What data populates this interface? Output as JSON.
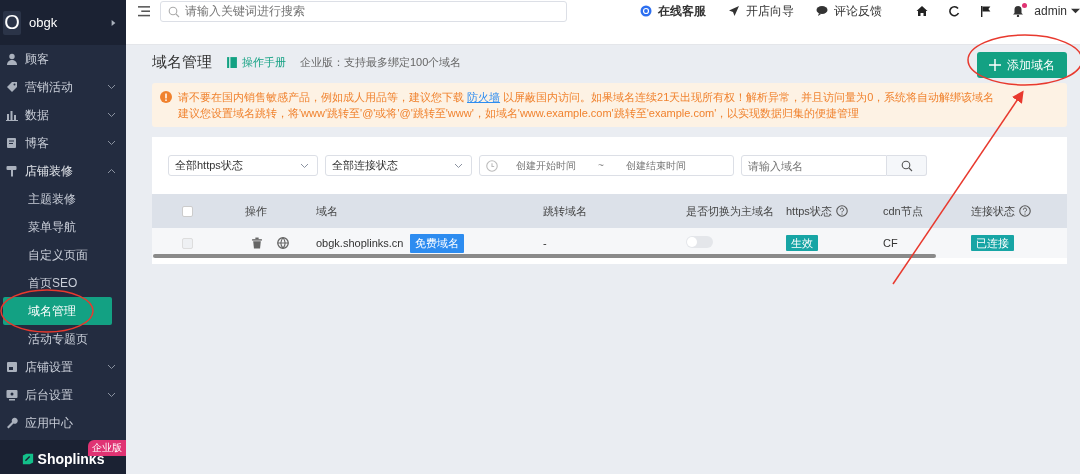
{
  "sidebar": {
    "store_name": "obgk",
    "logo_letter": "O",
    "items": [
      {
        "label": "顾客",
        "kind": "link",
        "selected": false
      },
      {
        "label": "营销活动",
        "kind": "group",
        "expanded": false,
        "selected": false
      },
      {
        "label": "数据",
        "kind": "group",
        "expanded": false,
        "selected": false
      },
      {
        "label": "博客",
        "kind": "group",
        "expanded": false,
        "selected": false
      },
      {
        "label": "店铺装修",
        "kind": "group",
        "expanded": true,
        "selected": false,
        "children": [
          {
            "label": "主题装修",
            "selected": false
          },
          {
            "label": "菜单导航",
            "selected": false
          },
          {
            "label": "自定义页面",
            "selected": false
          },
          {
            "label": "首页SEO",
            "selected": false
          },
          {
            "label": "域名管理",
            "selected": true
          },
          {
            "label": "活动专题页",
            "selected": false
          }
        ]
      },
      {
        "label": "店铺设置",
        "kind": "group",
        "expanded": false,
        "selected": false
      },
      {
        "label": "后台设置",
        "kind": "group",
        "expanded": false,
        "selected": false
      },
      {
        "label": "应用中心",
        "kind": "link",
        "selected": false
      }
    ],
    "brand": "Shoplinks",
    "edition_badge": "企业版"
  },
  "header": {
    "search_placeholder": "请输入关键词进行搜索",
    "links": [
      {
        "label": "在线客服",
        "bold": true
      },
      {
        "label": "开店向导",
        "bold": false
      },
      {
        "label": "评论反馈",
        "bold": false
      }
    ],
    "notification_dot": true,
    "user": "admin"
  },
  "page": {
    "title": "域名管理",
    "manual_link": "操作手册",
    "edition_note": "企业版：支持最多绑定100个域名",
    "add_button": "添加域名"
  },
  "notice": {
    "line1_before": "请不要在国内销售敏感产品，例如成人用品等，建议您下载",
    "line1_link": "防火墙",
    "line1_after": "以屏蔽国内访问。如果域名连续21天出现所有权！解析异常，并且访问量为0，系统将自动解绑该域名",
    "line2": "建议您设置域名跳转，将'www'跳转至'@'或将'@'跳转至'www'，如域名'www.example.com'跳转至'example.com'，以实现数据归集的便捷管理"
  },
  "filters": {
    "https_select": "全部https状态",
    "connection_select": "全部连接状态",
    "start_placeholder": "创建开始时间",
    "range_separator": "~",
    "end_placeholder": "创建结束时间",
    "domain_placeholder": "请输入域名"
  },
  "table": {
    "select_all_checked": false,
    "columns": [
      {
        "label": "操作"
      },
      {
        "label": "域名"
      },
      {
        "label": "跳转域名"
      },
      {
        "label": "是否切换为主域名"
      },
      {
        "label": "https状态",
        "help": true
      },
      {
        "label": "cdn节点"
      },
      {
        "label": "连接状态",
        "help": true
      }
    ],
    "rows": [
      {
        "checked": false,
        "disabled": true,
        "domain": "obgk.shoplinks.cn",
        "domain_tag": "免费域名",
        "redirect": "-",
        "main_domain": false,
        "https_status": "生效",
        "cdn": "CF",
        "connection": "已连接"
      }
    ]
  }
}
